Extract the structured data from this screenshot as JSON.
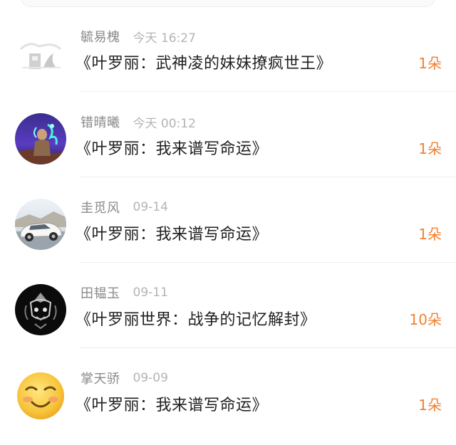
{
  "colors": {
    "amount": "#f0812f",
    "name": "#8a8a8a",
    "time": "#b4b4b4",
    "title": "#1f1f1f",
    "divider": "#efefef"
  },
  "rows": [
    {
      "avatar": "sketch-logo-avatar",
      "name": "毓易槐",
      "time": "今天 16:27",
      "book": "《叶罗丽：武神凌的妹妹撩疯世王》",
      "amount": "1朵"
    },
    {
      "avatar": "glowing-figure-avatar",
      "name": "错晴曦",
      "time": "今天 00:12",
      "book": "《叶罗丽：我来谱写命运》",
      "amount": "1朵"
    },
    {
      "avatar": "white-suv-avatar",
      "name": "圭觅风",
      "time": "09-14",
      "book": "《叶罗丽：我来谱写命运》",
      "amount": "1朵"
    },
    {
      "avatar": "dark-ornament-avatar",
      "name": "田韫玉",
      "time": "09-11",
      "book": "《叶罗丽世界：战争的记忆解封》",
      "amount": "10朵"
    },
    {
      "avatar": "smiley-face-avatar",
      "name": "掌天骄",
      "time": "09-09",
      "book": "《叶罗丽：我来谱写命运》",
      "amount": "1朵"
    }
  ]
}
